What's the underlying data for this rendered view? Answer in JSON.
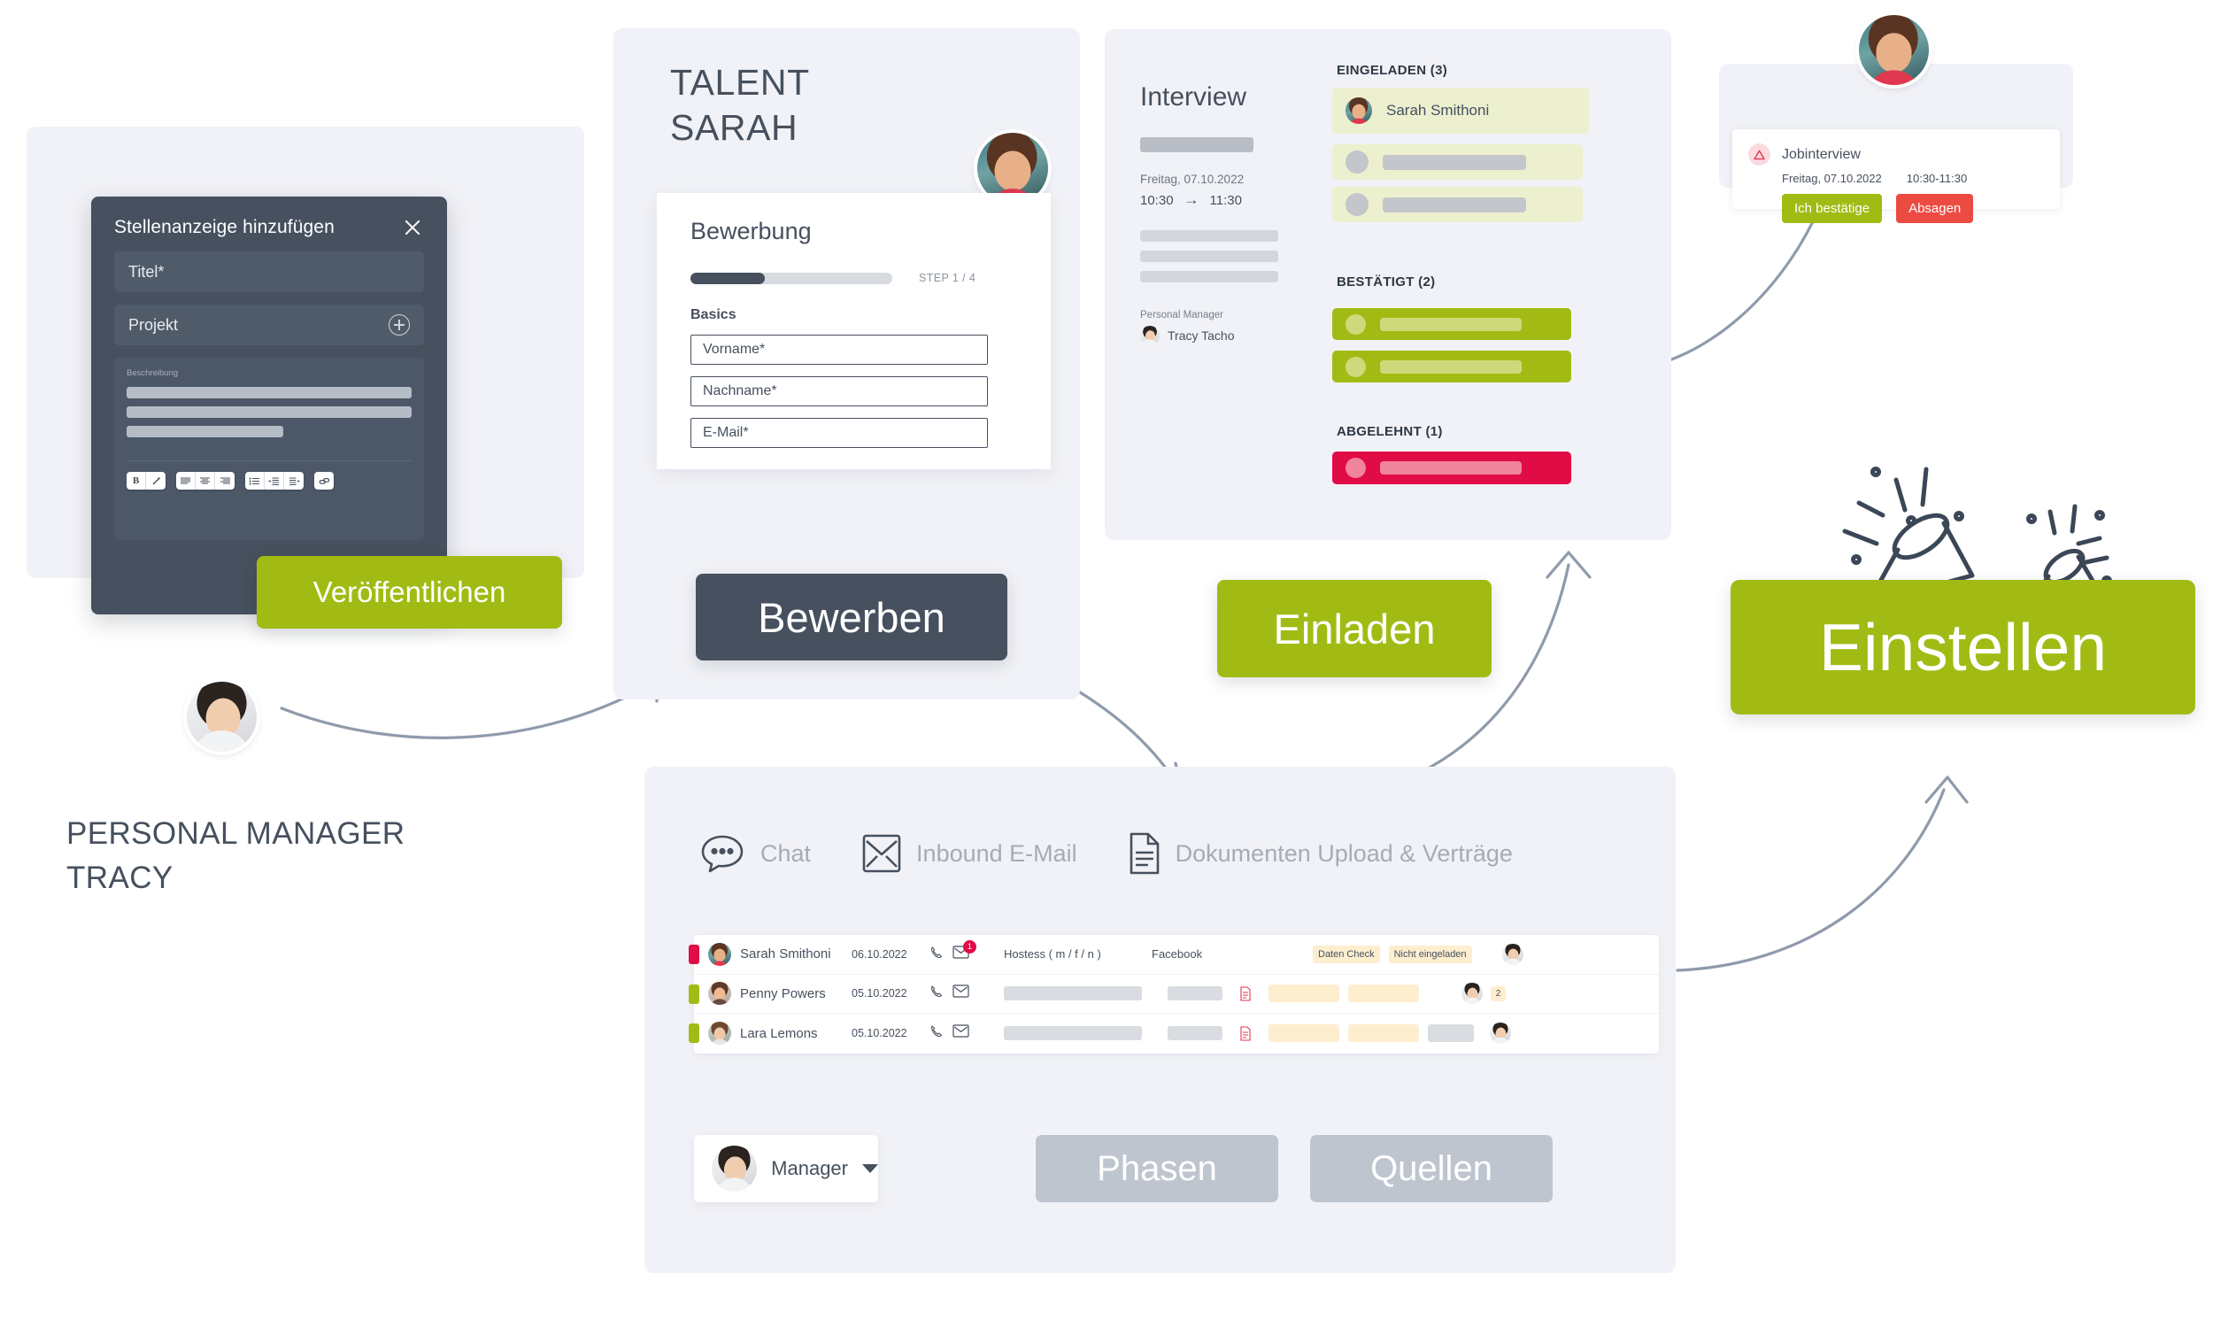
{
  "theme": {
    "bg": "#ffffff",
    "panel_bg": "#f1f2f7",
    "dark": "#46505e",
    "green": "#a2bb14",
    "red": "#ec4b42",
    "crimson": "#e10b45",
    "olive_light": "#edf0cf",
    "amber_tag": "#fdeecf",
    "gray_btn": "#bfc5cf"
  },
  "job_dialog": {
    "title": "Stellenanzeige hinzufügen",
    "close_label": "×",
    "fields": [
      {
        "label": "Titel*",
        "has_plus": false
      },
      {
        "label": "Projekt",
        "has_plus": true
      }
    ],
    "description_label": "Beschreibung",
    "toolbar": {
      "bold": "B",
      "italic": "I",
      "align_left": "align-left",
      "align_center": "align-center",
      "align_right": "align-right",
      "list_bullet": "bullet-list",
      "indent_increase": "indent-increase",
      "indent_decrease": "indent-decrease",
      "link": "link"
    }
  },
  "buttons": {
    "veroeffentlichen": "Veröffentlichen",
    "bewerben": "Bewerben",
    "einladen": "Einladen",
    "einstellen": "Einstellen"
  },
  "personal_manager": {
    "caption_line1": "PERSONAL MANAGER",
    "caption_line2": "TRACY",
    "avatar_name": "tracy-avatar"
  },
  "talent": {
    "title_line1": "TALENT",
    "title_line2": "SARAH",
    "avatar_name": "sarah-avatar",
    "card": {
      "title": "Bewerbung",
      "step_label": "STEP 1 / 4",
      "progress_percent": 25,
      "section": "Basics",
      "inputs": [
        {
          "placeholder": "Vorname*",
          "value": ""
        },
        {
          "placeholder": "Nachname*",
          "value": ""
        },
        {
          "placeholder": "E-Mail*",
          "value": ""
        }
      ]
    }
  },
  "interview": {
    "title": "Interview",
    "date": "Freitag, 07.10.2022",
    "time_start": "10:30",
    "time_arrow": "→",
    "time_end": "11:30",
    "pm_label": "Personal Manager",
    "pm_name": "Tracy Tacho",
    "groups": [
      {
        "heading": "EINGELADEN (3)",
        "color": "#edf0cf",
        "items": [
          {
            "label": "Sarah Smithoni",
            "named": true
          },
          {
            "label": "",
            "named": false
          },
          {
            "label": "",
            "named": false
          }
        ]
      },
      {
        "heading": "BESTÄTIGT (2)",
        "color": "#a2bb14",
        "items": [
          {
            "label": "",
            "named": false
          },
          {
            "label": "",
            "named": false
          }
        ]
      },
      {
        "heading": "ABGELEHNT (1)",
        "color": "#e10b45",
        "items": [
          {
            "label": "",
            "named": false
          }
        ]
      }
    ]
  },
  "notification": {
    "icon": "warning-triangle-icon",
    "title": "Jobinterview",
    "date": "Freitag, 07.10.2022",
    "time": "10:30-11:30",
    "confirm_label": "Ich bestätige",
    "decline_label": "Absagen"
  },
  "features": [
    {
      "icon": "chat-bubble-icon",
      "label": "Chat"
    },
    {
      "icon": "envelope-icon",
      "label": "Inbound E-Mail"
    },
    {
      "icon": "document-icon",
      "label": "Dokumenten Upload & Verträge"
    }
  ],
  "applicants_table": {
    "rows": [
      {
        "stripe_color": "#e10b45",
        "name": "Sarah Smithoni",
        "date": "06.10.2022",
        "phone_icon": "phone-icon",
        "mail_icon": "envelope-icon",
        "mail_badge": "1",
        "position": "Hostess ( m / f / n )",
        "source": "Facebook",
        "tags": [
          "Daten Check",
          "Nicht eingeladen"
        ],
        "doc_icon": "",
        "gray_tag": "",
        "count_badge": ""
      },
      {
        "stripe_color": "#a2bb14",
        "name": "Penny Powers",
        "date": "05.10.2022",
        "phone_icon": "phone-icon",
        "mail_icon": "envelope-icon",
        "mail_badge": "",
        "position": "",
        "source": "",
        "tags": [
          "",
          ""
        ],
        "doc_icon": "document-red-icon",
        "gray_tag": "",
        "count_badge": "2"
      },
      {
        "stripe_color": "#a2bb14",
        "name": "Lara Lemons",
        "date": "05.10.2022",
        "phone_icon": "phone-icon",
        "mail_icon": "envelope-icon",
        "mail_badge": "",
        "position": "",
        "source": "",
        "tags": [
          "",
          ""
        ],
        "doc_icon": "document-red-icon",
        "gray_tag": "gray",
        "count_badge": ""
      }
    ]
  },
  "footer_controls": {
    "manager_label": "Manager",
    "manager_caret": "chevron-down-icon",
    "phasen_label": "Phasen",
    "quellen_label": "Quellen"
  },
  "decorations": {
    "confetti_icon": "party-popper-icon",
    "arrows": [
      "tracy-to-bewerben",
      "bewerben-to-table",
      "table-to-interview",
      "notify-to-interview",
      "table-to-einstellen"
    ]
  }
}
